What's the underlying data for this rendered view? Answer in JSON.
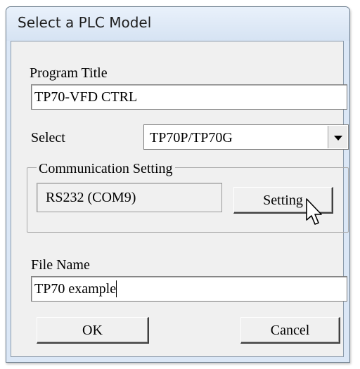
{
  "window": {
    "title": "Select a PLC Model"
  },
  "program_title": {
    "label": "Program Title",
    "value": "TP70-VFD CTRL"
  },
  "select": {
    "label": "Select",
    "value": "TP70P/TP70G",
    "icon": "chevron-down-icon"
  },
  "communication": {
    "group_label": "Communication Setting",
    "port_value": "RS232 (COM9)",
    "setting_button": "Setting"
  },
  "file_name": {
    "label": "File Name",
    "value": "TP70 example"
  },
  "buttons": {
    "ok": "OK",
    "cancel": "Cancel"
  },
  "cursor_icon": "pointer-arrow-icon"
}
